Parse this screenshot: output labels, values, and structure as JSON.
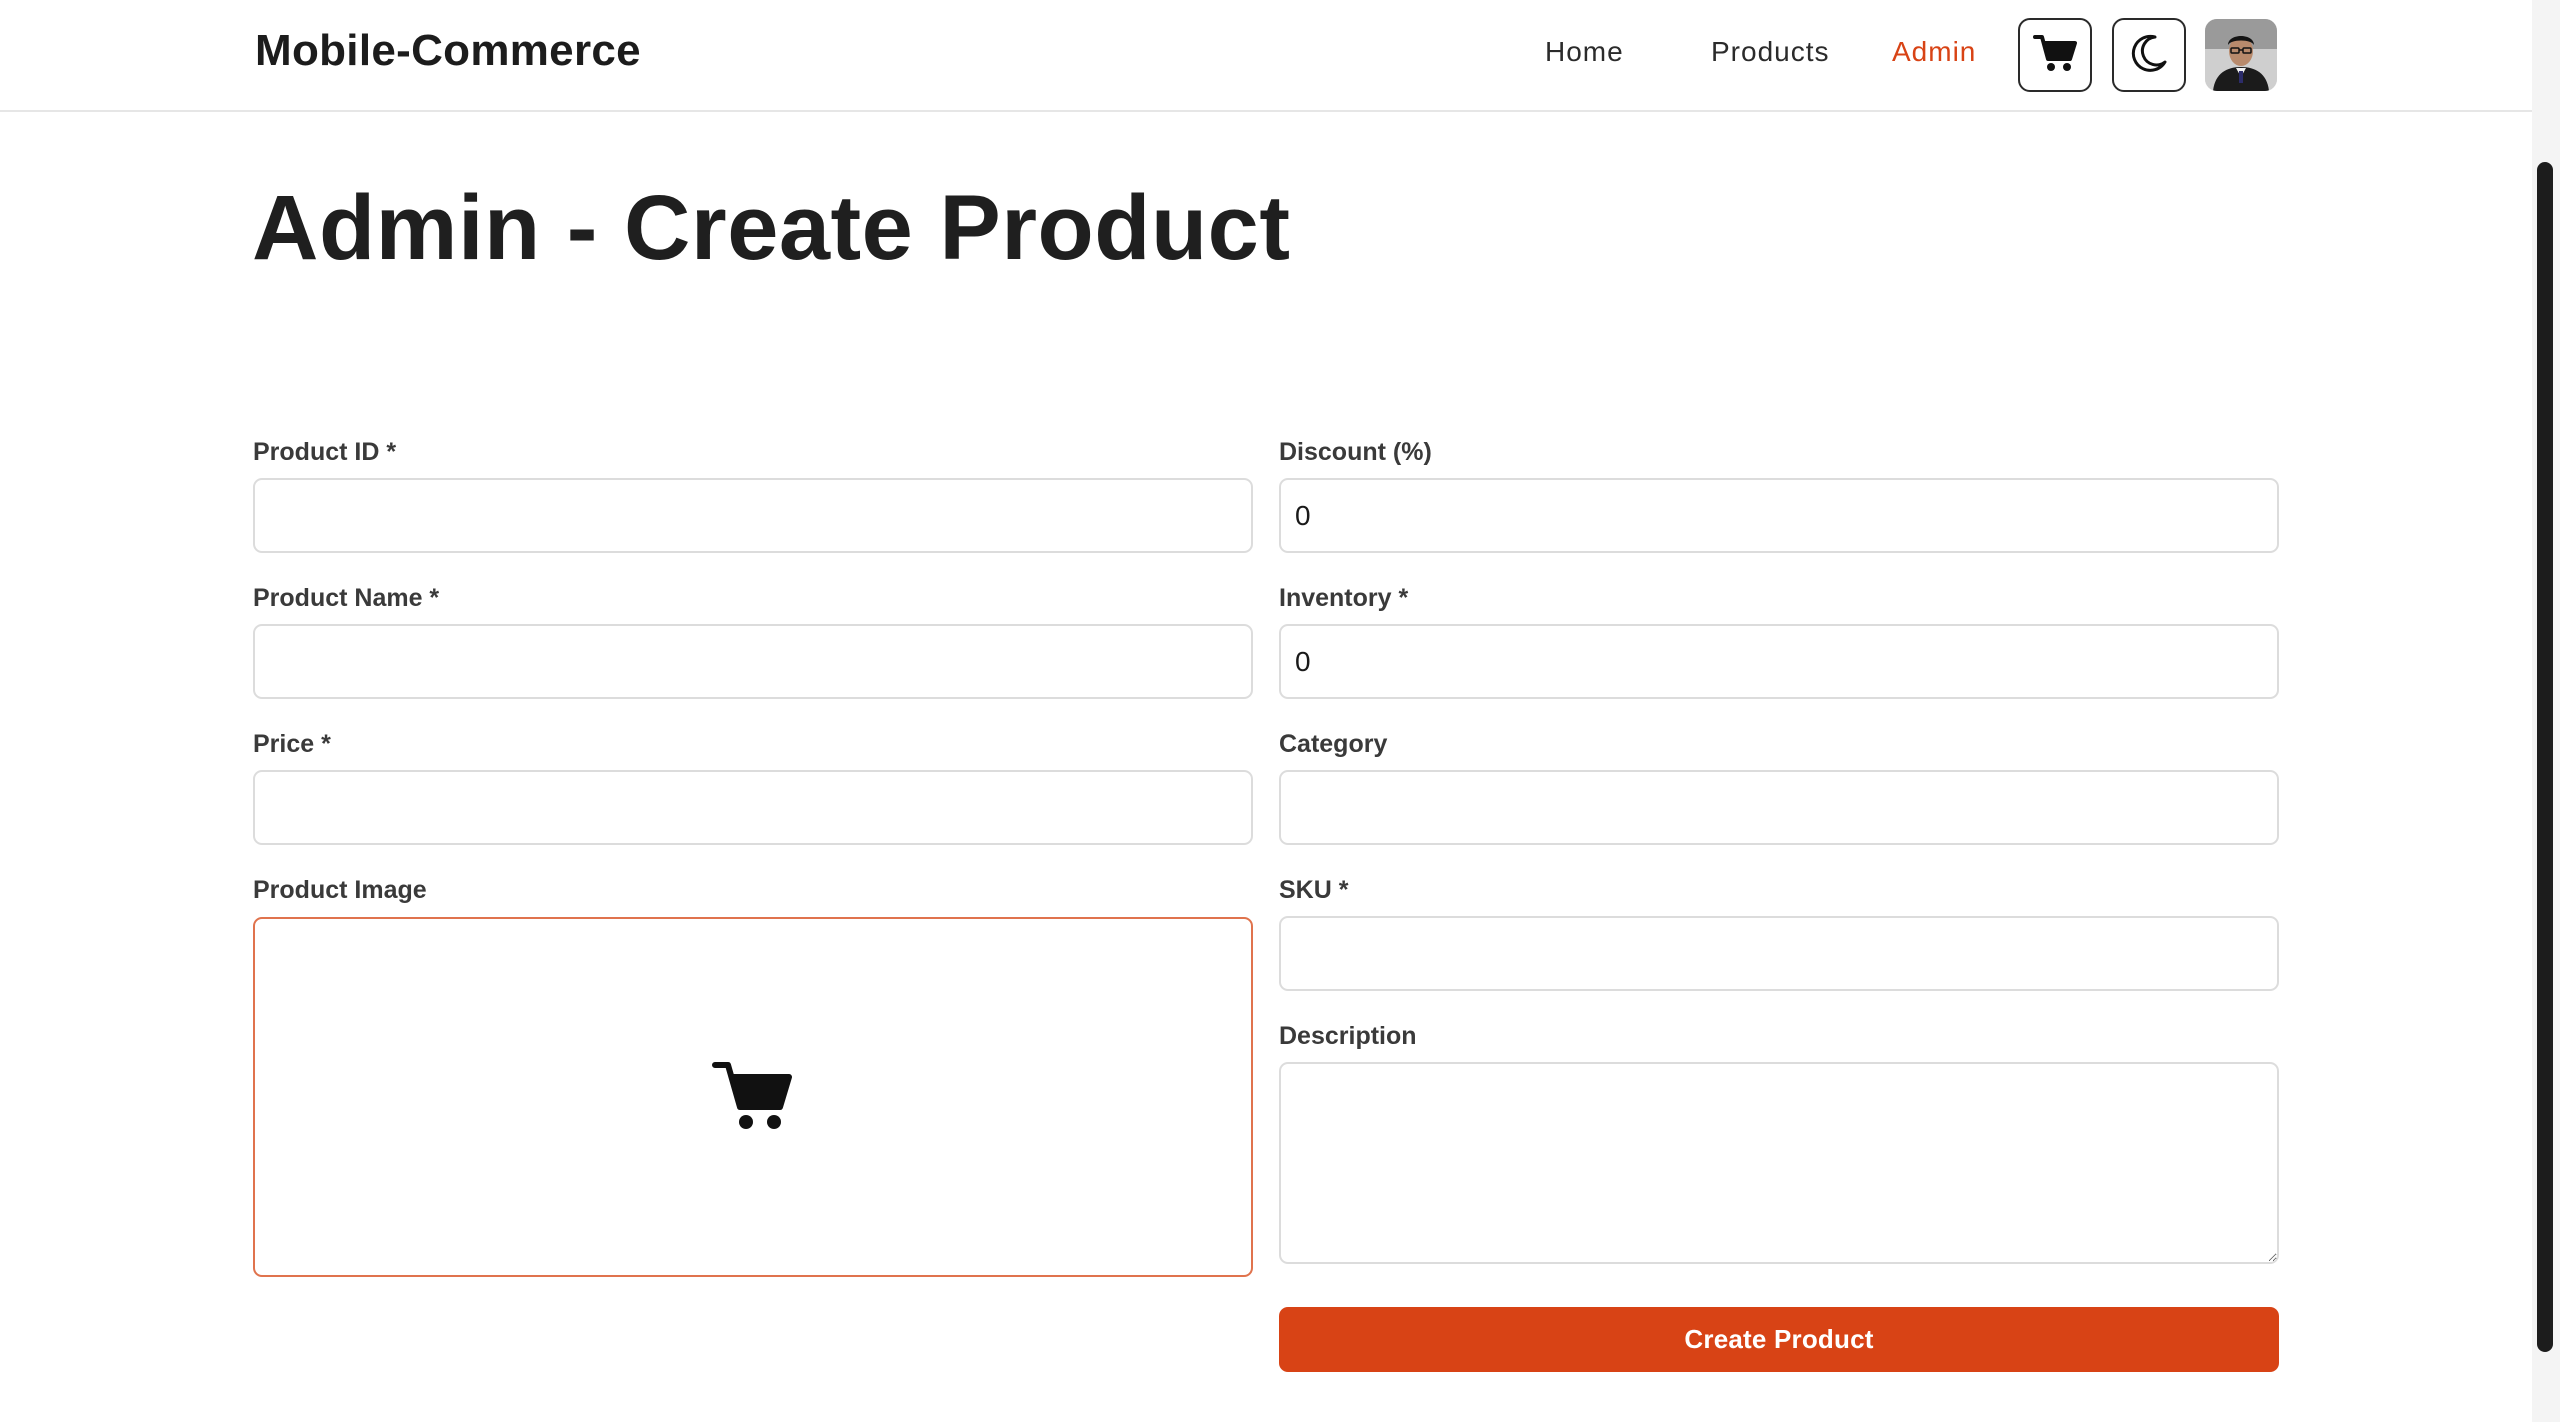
{
  "header": {
    "brand": "Mobile-Commerce",
    "nav": {
      "home": "Home",
      "products": "Products",
      "admin": "Admin"
    },
    "active_nav": "Admin",
    "accent_color": "#d84315",
    "icons": {
      "cart": "cart-icon",
      "theme": "moon-icon",
      "profile": "avatar"
    }
  },
  "page": {
    "title": "Admin - Create Product"
  },
  "form": {
    "product_id": {
      "label": "Product ID *",
      "value": ""
    },
    "product_name": {
      "label": "Product Name *",
      "value": ""
    },
    "price": {
      "label": "Price *",
      "value": ""
    },
    "product_image": {
      "label": "Product Image",
      "icon": "cart-icon"
    },
    "discount": {
      "label": "Discount (%)",
      "value": "0"
    },
    "inventory": {
      "label": "Inventory *",
      "value": "0"
    },
    "category": {
      "label": "Category",
      "value": ""
    },
    "sku": {
      "label": "SKU *",
      "value": ""
    },
    "description": {
      "label": "Description",
      "value": ""
    },
    "submit_label": "Create Product"
  }
}
